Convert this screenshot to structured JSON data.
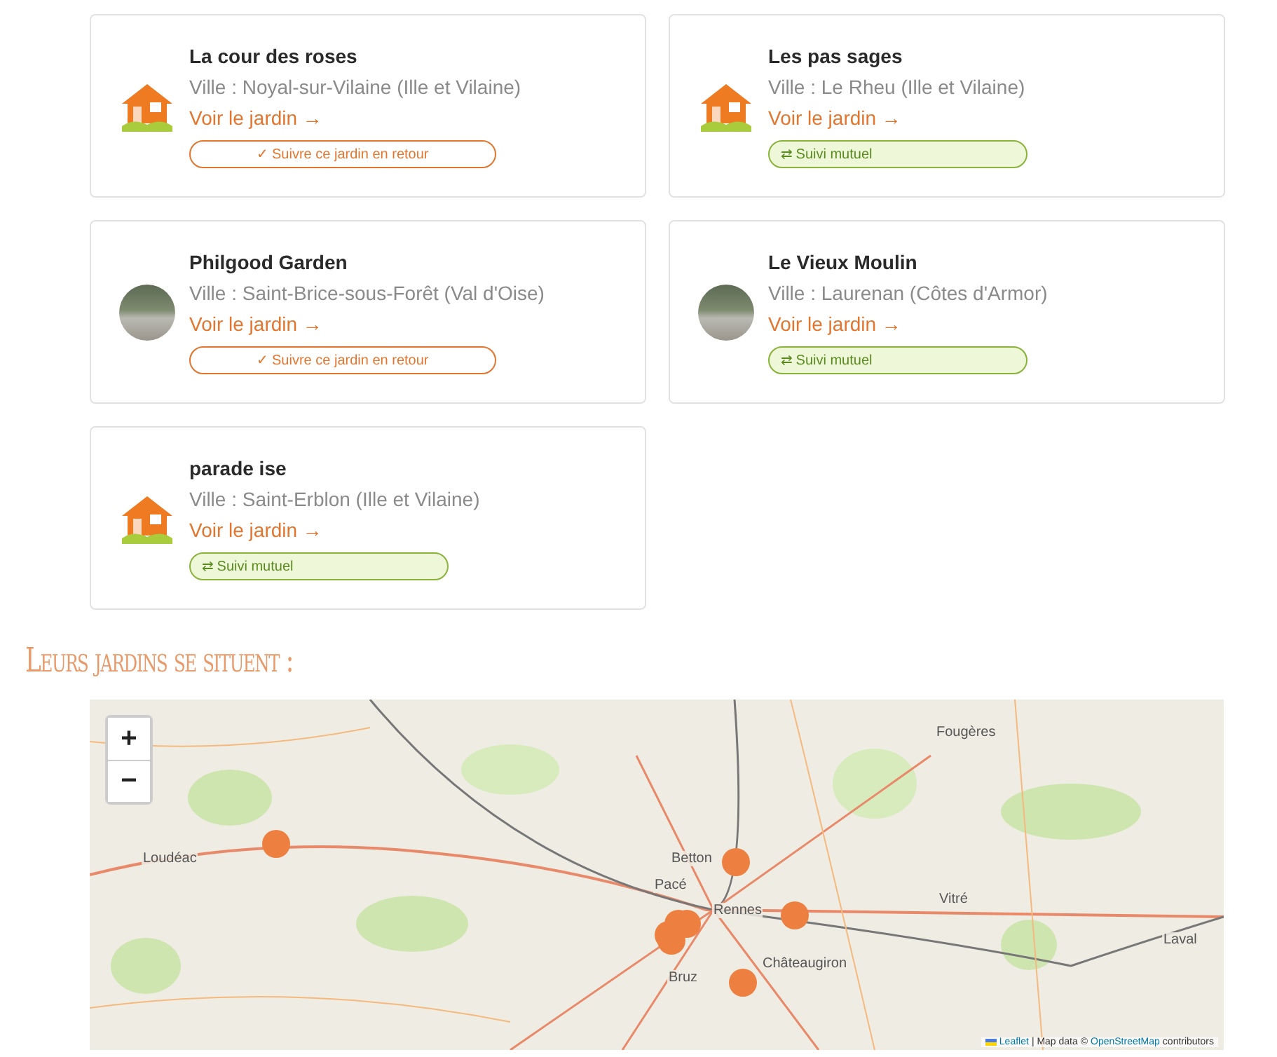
{
  "gardens": [
    {
      "name": "La cour des roses",
      "city": "Ville : Noyal-sur-Vilaine (Ille et Vilaine)",
      "link": "Voir le jardin →",
      "avatar": {
        "kind": "house"
      },
      "follow": {
        "kind": "follow",
        "label": "✓ Suivre ce jardin en retour"
      }
    },
    {
      "name": "Les pas sages",
      "city": "Ville : Le Rheu (Ille et Vilaine)",
      "link": "Voir le jardin →",
      "avatar": {
        "kind": "house"
      },
      "follow": {
        "kind": "mutual",
        "label": "⇄ Suivi mutuel"
      }
    },
    {
      "name": "Philgood Garden",
      "city": "Ville : Saint-Brice-sous-Forêt (Val d'Oise)",
      "link": "Voir le jardin →",
      "avatar": {
        "kind": "photo"
      },
      "follow": {
        "kind": "follow",
        "label": "✓ Suivre ce jardin en retour"
      }
    },
    {
      "name": "Le Vieux Moulin",
      "city": "Ville : Laurenan (Côtes d'Armor)",
      "link": "Voir le jardin →",
      "avatar": {
        "kind": "photo"
      },
      "follow": {
        "kind": "mutual",
        "label": "⇄ Suivi mutuel"
      }
    },
    {
      "name": "parade ise",
      "city": "Ville : Saint-Erblon (Ille et Vilaine)",
      "link": "Voir le jardin →",
      "avatar": {
        "kind": "house"
      },
      "follow": {
        "kind": "mutual",
        "label": "⇄ Suivi mutuel"
      }
    }
  ],
  "map_heading": "Leurs jardins se situent :",
  "map": {
    "zoom_in": "+",
    "zoom_out": "−",
    "places": [
      "Fougères",
      "Loudéac",
      "Betton",
      "Pacé",
      "Rennes",
      "Vitré",
      "Châteaugiron",
      "Bruz",
      "Laval"
    ],
    "attribution": {
      "leaflet": "Leaflet",
      "text": "| Map data ©",
      "osm": "OpenStreetMap",
      "suffix": "contributors"
    }
  }
}
